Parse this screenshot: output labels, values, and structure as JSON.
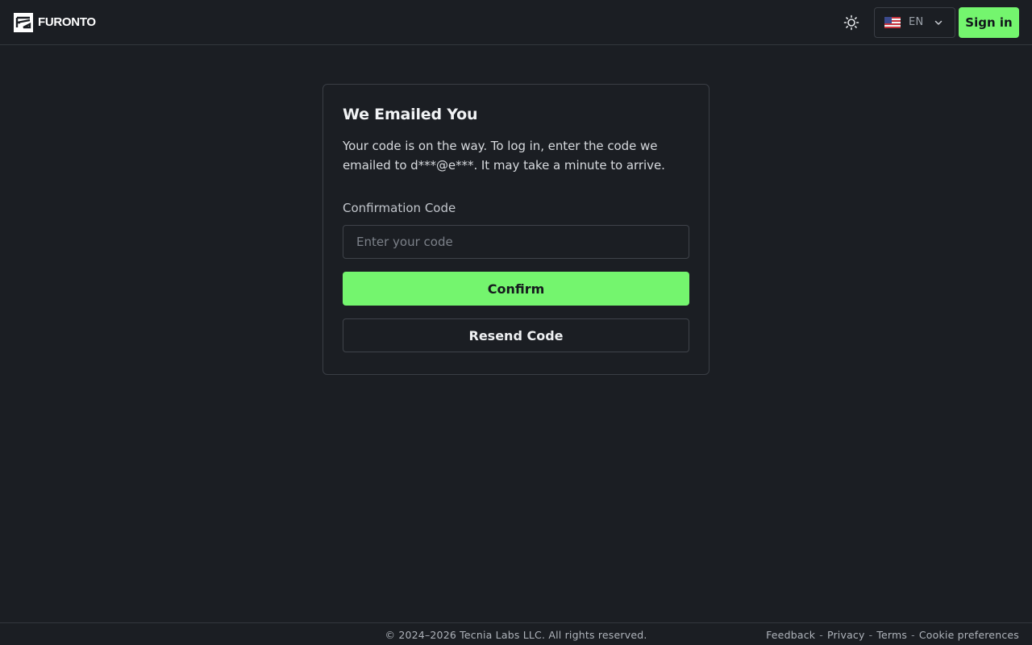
{
  "header": {
    "brand_name": "FURONTO",
    "brand_icon": "furonto-logo-icon",
    "theme_icon": "sun-icon",
    "language": {
      "flag_icon": "us-flag-icon",
      "code": "EN",
      "chevron_icon": "chevron-down-icon"
    },
    "signin_label": "Sign in"
  },
  "card": {
    "title": "We Emailed You",
    "description": "Your code is on the way. To log in, enter the code we emailed to d***@e***. It may take a minute to arrive.",
    "field_label": "Confirmation Code",
    "input_value": "",
    "input_placeholder": "Enter your code",
    "confirm_label": "Confirm",
    "resend_label": "Resend Code"
  },
  "footer": {
    "copyright": "© 2024–2026 Tecnia Labs LLC. All rights reserved.",
    "links": [
      "Feedback",
      "Privacy",
      "Terms",
      "Cookie preferences"
    ],
    "separator": "-"
  },
  "colors": {
    "background": "#1b1e23",
    "accent": "#74f56e",
    "border": "#3a3e45"
  }
}
